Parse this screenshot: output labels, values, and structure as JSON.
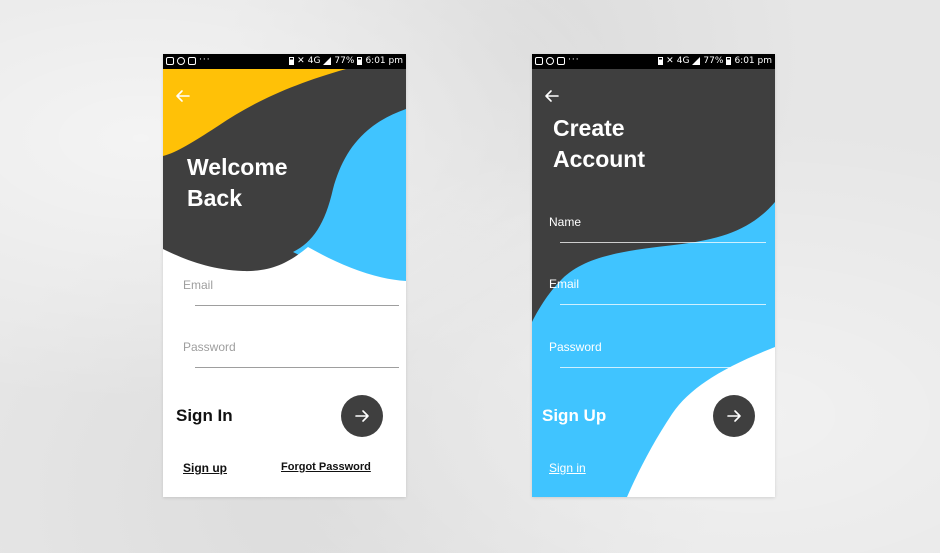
{
  "status_bar": {
    "battery": "77%",
    "time": "6:01 pm",
    "network": "4G"
  },
  "signin": {
    "title_line1": "Welcome",
    "title_line2": "Back",
    "email_label": "Email",
    "password_label": "Password",
    "action_label": "Sign In",
    "signup_link": "Sign up",
    "forgot_link": "Forgot Password"
  },
  "signup": {
    "title_line1": "Create",
    "title_line2": "Account",
    "name_label": "Name",
    "email_label": "Email",
    "password_label": "Password",
    "action_label": "Sign Up",
    "signin_link": "Sign in"
  },
  "colors": {
    "dark": "#3f3f3f",
    "yellow": "#ffc107",
    "blue": "#40c4ff",
    "white": "#ffffff"
  }
}
